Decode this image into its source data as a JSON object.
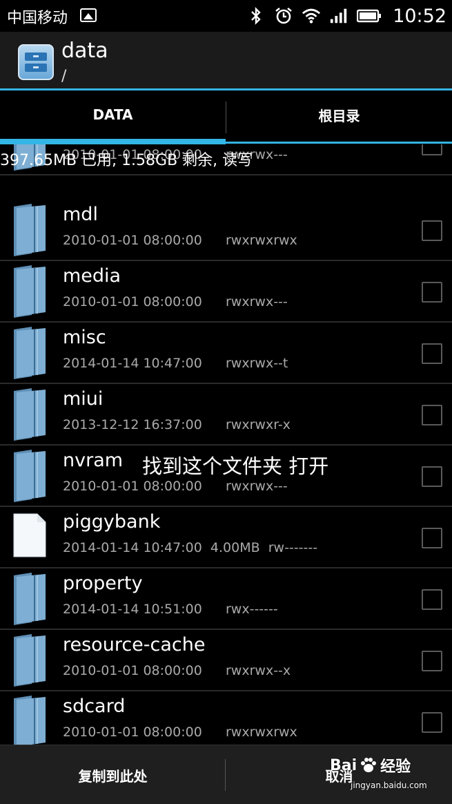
{
  "status_bar": {
    "carrier": "中国移动",
    "time": "10:52"
  },
  "header": {
    "title": "data",
    "path": "/"
  },
  "tabs": [
    {
      "label": "DATA"
    },
    {
      "label": "根目录"
    }
  ],
  "storage_info": "397.65MB 已用, 1.58GB 剩余, 读写",
  "files": [
    {
      "type": "folder",
      "name": "",
      "date": "2010-01-01 08:00:00",
      "size": "",
      "perms": "rwxrwx---"
    },
    {
      "type": "folder",
      "name": "mdl",
      "date": "2010-01-01 08:00:00",
      "size": "",
      "perms": "rwxrwxrwx"
    },
    {
      "type": "folder",
      "name": "media",
      "date": "2010-01-01 08:00:00",
      "size": "",
      "perms": "rwxrwx---"
    },
    {
      "type": "folder",
      "name": "misc",
      "date": "2014-01-14 10:47:00",
      "size": "",
      "perms": "rwxrwx--t"
    },
    {
      "type": "folder",
      "name": "miui",
      "date": "2013-12-12 16:37:00",
      "size": "",
      "perms": "rwxrwxr-x"
    },
    {
      "type": "folder",
      "name": "nvram",
      "date": "2010-01-01 08:00:00",
      "size": "",
      "perms": "rwxrwx---"
    },
    {
      "type": "file",
      "name": "piggybank",
      "date": "2014-01-14 10:47:00",
      "size": "4.00MB",
      "perms": "rw-------"
    },
    {
      "type": "folder",
      "name": "property",
      "date": "2014-01-14 10:51:00",
      "size": "",
      "perms": "rwx------"
    },
    {
      "type": "folder",
      "name": "resource-cache",
      "date": "2010-01-01 08:00:00",
      "size": "",
      "perms": "rwxrwx--x"
    },
    {
      "type": "folder",
      "name": "sdcard",
      "date": "2010-01-01 08:00:00",
      "size": "",
      "perms": "rwxrwxrwx"
    }
  ],
  "annotation": "找到这个文件夹 打开",
  "bottom_bar": {
    "copy_here": "复制到此处",
    "cancel": "取消"
  },
  "watermark": {
    "brand": "Bai",
    "suffix": "经验",
    "url": "jingyan.baidu.com"
  },
  "colors": {
    "accent": "#33b5e5",
    "folder": "#6f9fc4"
  }
}
